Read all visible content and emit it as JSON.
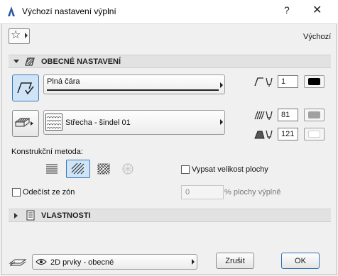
{
  "window": {
    "title": "Výchozí nastavení výplní",
    "help_glyph": "?",
    "close_glyph": "✕"
  },
  "favorites": {
    "star_glyph": "☆",
    "preset_label": "Výchozí"
  },
  "general_section": {
    "title": "OBECNÉ NASTAVENÍ",
    "line_type": {
      "label": "Plná čára",
      "pen_number": "1",
      "pen_color": "#000000"
    },
    "fill_type": {
      "label": "Střecha - šindel 01",
      "foreground_pen": "81",
      "foreground_color": "#a0a0a0",
      "background_pen": "121",
      "background_color": "#ffffff"
    },
    "construction_method_label": "Konstrukční metoda:",
    "show_area_label": "Vypsat velikost plochy",
    "subtract_zones_label": "Odečíst ze zón",
    "subtract_value": "0",
    "subtract_suffix": "% plochy výplně"
  },
  "properties_section": {
    "title": "VLASTNOSTI"
  },
  "footer": {
    "layer_label": "2D prvky - obecné",
    "cancel_label": "Zrušit",
    "ok_label": "OK"
  },
  "colors": {
    "accent": "#3a78b8",
    "active_button_bg": "#cfe4f7"
  },
  "icons": [
    "app-icon",
    "star-icon",
    "fill-settings-icon",
    "line-type-icon",
    "fill-type-icon",
    "pen-icon",
    "fg-pen-icon",
    "bg-pen-icon",
    "properties-icon",
    "layer-icon",
    "eye-icon"
  ]
}
